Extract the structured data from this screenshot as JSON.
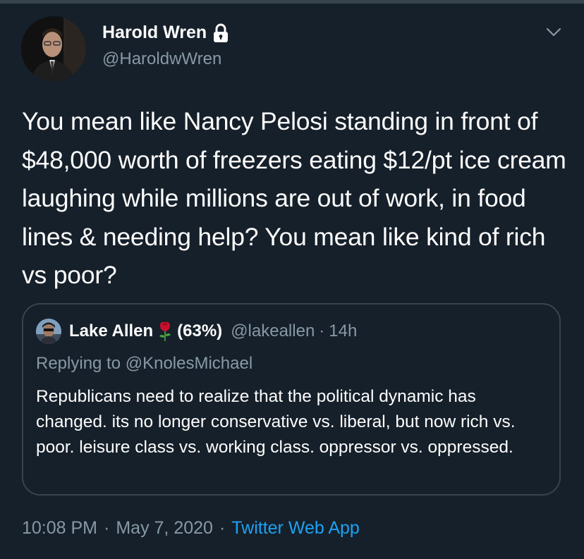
{
  "tweet": {
    "author": {
      "display_name": "Harold Wren",
      "handle": "@HaroldwWren",
      "protected_icon": "lock-icon",
      "avatar": "profile-photo"
    },
    "menu_icon": "chevron-down-icon",
    "text": "You mean like Nancy Pelosi standing in front of $48,000 worth of freezers eating $12/pt ice cream laughing while millions are out of work, in food lines & needing help? You mean like kind of rich vs poor?",
    "quoted_tweet": {
      "author_name": "Lake Allen",
      "name_emoji": "rose-icon",
      "name_suffix": "(63%)",
      "handle": "@lakeallen",
      "separator": "·",
      "time": "14h",
      "replying_to": "Replying to @KnolesMichael",
      "text": "Republicans need to realize that the political dynamic has changed. its no longer conservative vs. liberal, but now rich vs. poor. leisure class vs. working class. oppressor vs. oppressed."
    },
    "meta": {
      "time": "10:08 PM",
      "separator": "·",
      "date": "May 7, 2020",
      "source": "Twitter Web App"
    }
  },
  "colors": {
    "background": "#15202b",
    "border": "#38444d",
    "secondary_text": "#8899a6",
    "link": "#1da1f2",
    "primary_text": "#ffffff"
  }
}
